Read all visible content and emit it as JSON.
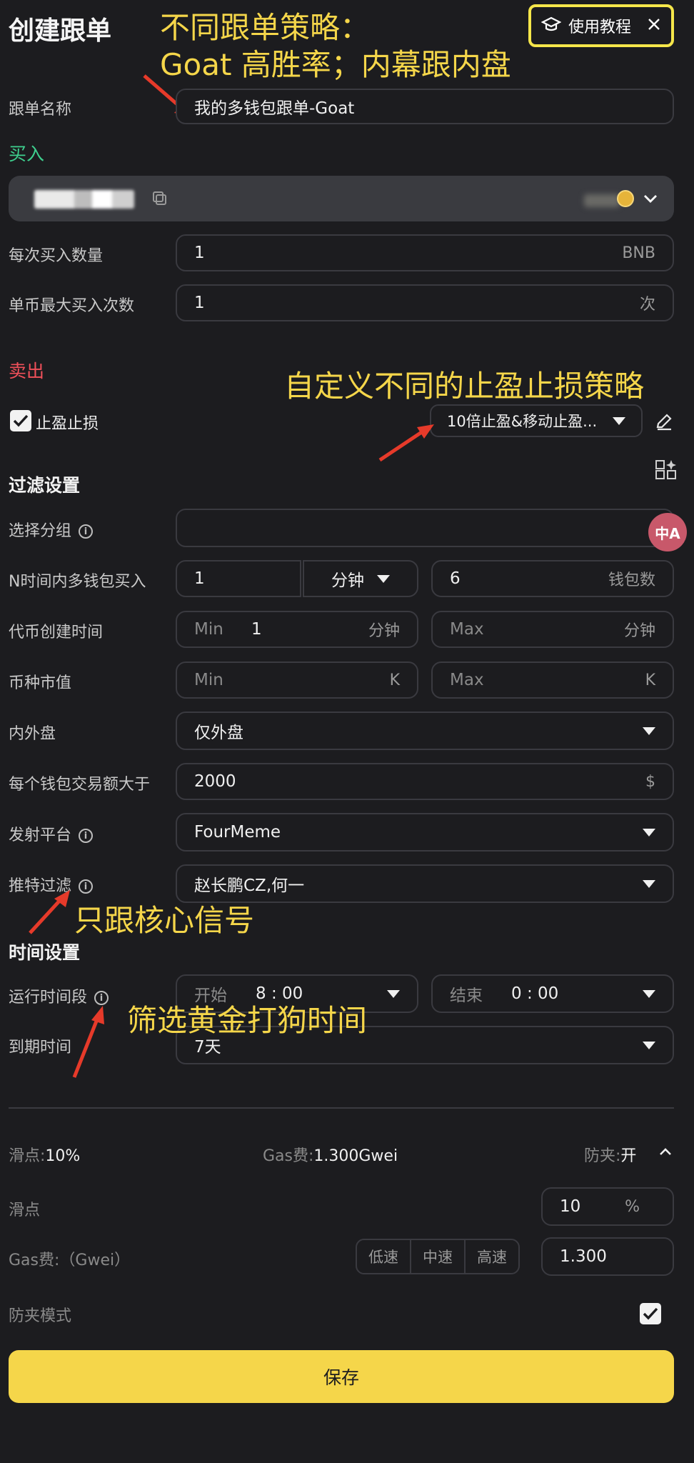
{
  "header": {
    "title": "创建跟单",
    "tutorial_label": "使用教程",
    "close_icon": "close-icon"
  },
  "annotations": {
    "strategy_line1": "不同跟单策略：",
    "strategy_line2": "Goat 高胜率；内幕跟内盘",
    "stoploss": "自定义不同的止盈止损策略",
    "core_signal": "只跟核心信号",
    "golden_time": "筛选黄金打狗时间"
  },
  "form": {
    "name_label": "跟单名称",
    "name_value": "我的多钱包跟单-Goat",
    "buy_title": "买入",
    "amount_label": "每次买入数量",
    "amount_value": "1",
    "amount_unit": "BNB",
    "max_buy_label": "单币最大买入次数",
    "max_buy_value": "1",
    "max_buy_unit": "次",
    "sell_title": "卖出",
    "tpsl_label": "止盈止损",
    "tpsl_value": "10倍止盈&移动止盈..."
  },
  "filter": {
    "title": "过滤设置",
    "group_label": "选择分组",
    "group_value": "",
    "n_time_label": "N时间内多钱包买入",
    "n_time_value": "1",
    "n_time_unit": "分钟",
    "wallet_count_value": "6",
    "wallet_count_unit": "钱包数",
    "create_time_label": "代币创建时间",
    "create_min_ph": "Min",
    "create_min_value": "1",
    "create_min_unit": "分钟",
    "create_max_ph": "Max",
    "create_max_unit": "分钟",
    "mcap_label": "币种市值",
    "mcap_min_ph": "Min",
    "mcap_min_unit": "K",
    "mcap_max_ph": "Max",
    "mcap_max_unit": "K",
    "market_label": "内外盘",
    "market_value": "仅外盘",
    "trade_amount_label": "每个钱包交易额大于",
    "trade_amount_value": "2000",
    "trade_amount_unit": "$",
    "platform_label": "发射平台",
    "platform_value": "FourMeme",
    "twitter_label": "推特过滤",
    "twitter_value": "赵长鹏CZ,何一"
  },
  "time": {
    "title": "时间设置",
    "run_label": "运行时间段",
    "start_ph": "开始",
    "start_value": "8 : 00",
    "end_ph": "结束",
    "end_value": "0 : 00",
    "expire_label": "到期时间",
    "expire_value": "7天"
  },
  "gas": {
    "slippage_summary_label": "滑点:",
    "slippage_summary_value": "10%",
    "gas_summary_label": "Gas费:",
    "gas_summary_value": "1.300Gwei",
    "antisandwich_summary_label": "防夹:",
    "antisandwich_summary_value": "开",
    "slippage_label": "滑点",
    "slippage_value": "10",
    "slippage_unit": "%",
    "gas_label": "Gas费:（Gwei）",
    "speed_low": "低速",
    "speed_mid": "中速",
    "speed_high": "高速",
    "gas_value": "1.300",
    "antisandwich_label": "防夹模式"
  },
  "save_label": "保存",
  "colors": {
    "accent": "#f5d64a",
    "buy": "#3ecf8e",
    "sell": "#f0505a",
    "bg": "#1c1c1f"
  }
}
